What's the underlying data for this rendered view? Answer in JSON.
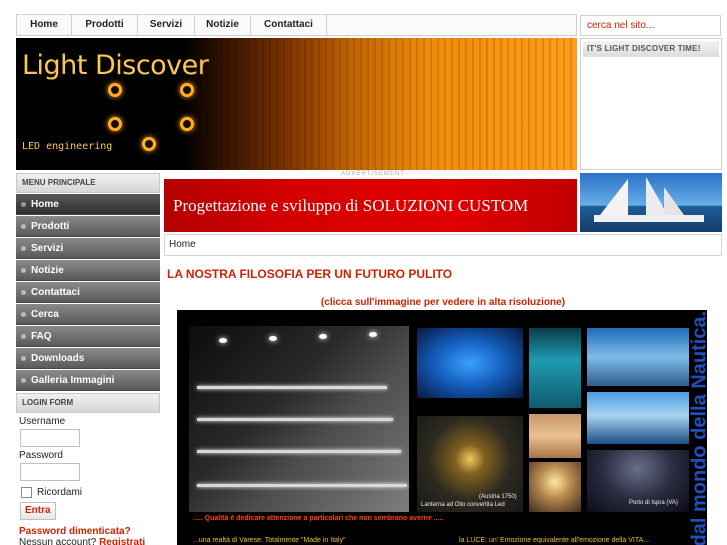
{
  "topnav": {
    "items": [
      {
        "label": "Home"
      },
      {
        "label": "Prodotti"
      },
      {
        "label": "Servizi"
      },
      {
        "label": "Notizie"
      },
      {
        "label": "Contattaci"
      }
    ]
  },
  "search": {
    "placeholder": "cerca nel sito..."
  },
  "banner": {
    "logo": "Light Discover",
    "tagline": "LED engineering"
  },
  "timebox": {
    "title": "IT'S LIGHT DISCOVER TIME!"
  },
  "sidebar": {
    "menu_title": "MENU PRINCIPALE",
    "menu": [
      {
        "label": "Home"
      },
      {
        "label": "Prodotti"
      },
      {
        "label": "Servizi"
      },
      {
        "label": "Notizie"
      },
      {
        "label": "Contattaci"
      },
      {
        "label": "Cerca"
      },
      {
        "label": "FAQ"
      },
      {
        "label": "Downloads"
      },
      {
        "label": "Galleria Immagini"
      }
    ],
    "login": {
      "title": "LOGIN FORM",
      "username_label": "Username",
      "password_label": "Password",
      "remember_label": "Ricordami",
      "submit_label": "Entra",
      "forgot_label": "Password dimenticata?",
      "no_account_label": "Nessun account?",
      "register_label": "Registrati"
    }
  },
  "ad": {
    "label": "ADVERTISEMENT",
    "text": "Progettazione e sviluppo di SOLUZIONI CUSTOM"
  },
  "breadcrumb": {
    "text": "Home"
  },
  "article": {
    "title": "LA NOSTRA FILOSOFIA PER UN FUTURO PULITO",
    "caption": "(clicca sull'immagine per vedere in alta risoluzione)",
    "collage": {
      "side_text": "dal mondo della Nautica...",
      "quality_text": "..... Qualità è dedicare attenzione a particolari che non sembrano averne .....",
      "lamp_caption_1": "(Austria 1750)",
      "lamp_caption_2": "Lanterna ad Olio convertita Led",
      "night_caption": "Porto di Ispra (VA)",
      "bottom_left": "...una realtà di Varese. Totalmente \"Made in Italy\"",
      "bottom_right": "la LUCE: un' Emozione equivalente all'emozione della VITA..."
    }
  },
  "colors": {
    "accent": "#cc2200",
    "menu_bg": "#6a6a6a",
    "banner_orange": "#f08c0a",
    "ad_red": "#d40000"
  }
}
